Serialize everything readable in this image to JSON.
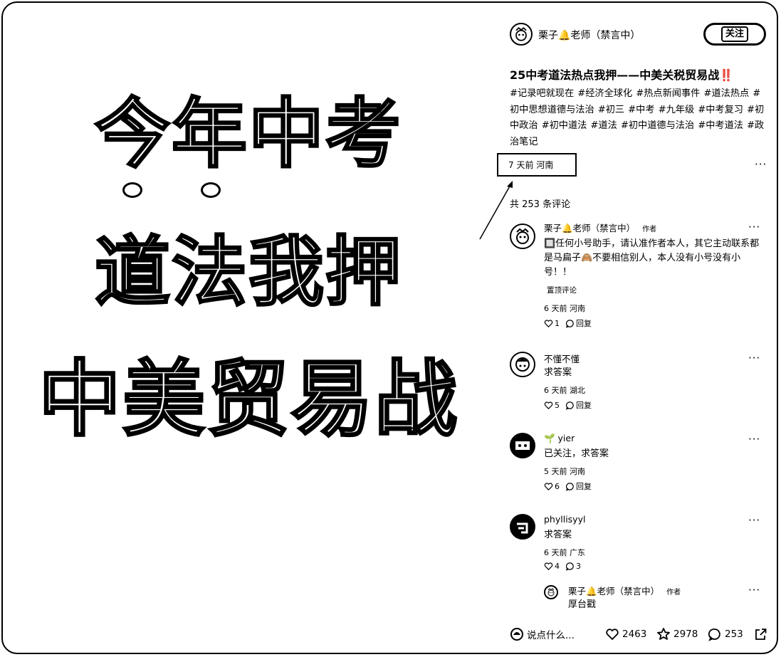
{
  "cover": {
    "line1": "今年中考",
    "line2": "道法我押",
    "line3": "中美贸易战"
  },
  "author": {
    "name": "栗子🔔老师（禁言中）",
    "follow_label": "关注"
  },
  "post": {
    "title": "25中考道法热点我押——中美关税贸易战‼️",
    "tags": [
      "#记录吧就现在",
      "#经济全球化",
      "#热点新闻事件",
      "#道法热点",
      "#初中思想道德与法治",
      "#初三",
      "#中考",
      "#九年级",
      "#中考复习",
      "#初中政治",
      "#初中道法",
      "#道法",
      "#初中道德与法治",
      "#中考道法",
      "#政治笔记"
    ],
    "meta": "7 天前 河南",
    "more": "···"
  },
  "comments_header": "共 253 条评论",
  "comments": [
    {
      "name": "栗子🔔老师（禁言中）",
      "tag": "作者",
      "text": "🔲任何小号助手，请认准作者本人，其它主动联系都是马扁子🙈不要相信别人，本人没有小号没有小号！！",
      "pin": "置顶评论",
      "meta": "6 天前 河南",
      "likes": "1",
      "reply": "回复"
    },
    {
      "name": "不懂不懂",
      "text": "求答案",
      "meta": "6 天前 湖北",
      "likes": "5",
      "reply": "回复"
    },
    {
      "name": "🌱 yier",
      "text": "已关注，求答案",
      "meta": "5 天前 河南",
      "likes": "6",
      "reply": "回复"
    },
    {
      "name": "phyllisyyl",
      "text": "求答案",
      "meta": "6 天前 广东",
      "likes": "4",
      "replies": "3"
    }
  ],
  "sub_reply": {
    "name": "栗子🔔老师（禁言中）",
    "tag": "作者",
    "text": "厚台戳"
  },
  "bottom": {
    "input_placeholder": "说点什么...",
    "likes": "2463",
    "stars": "2978",
    "comments": "253"
  }
}
